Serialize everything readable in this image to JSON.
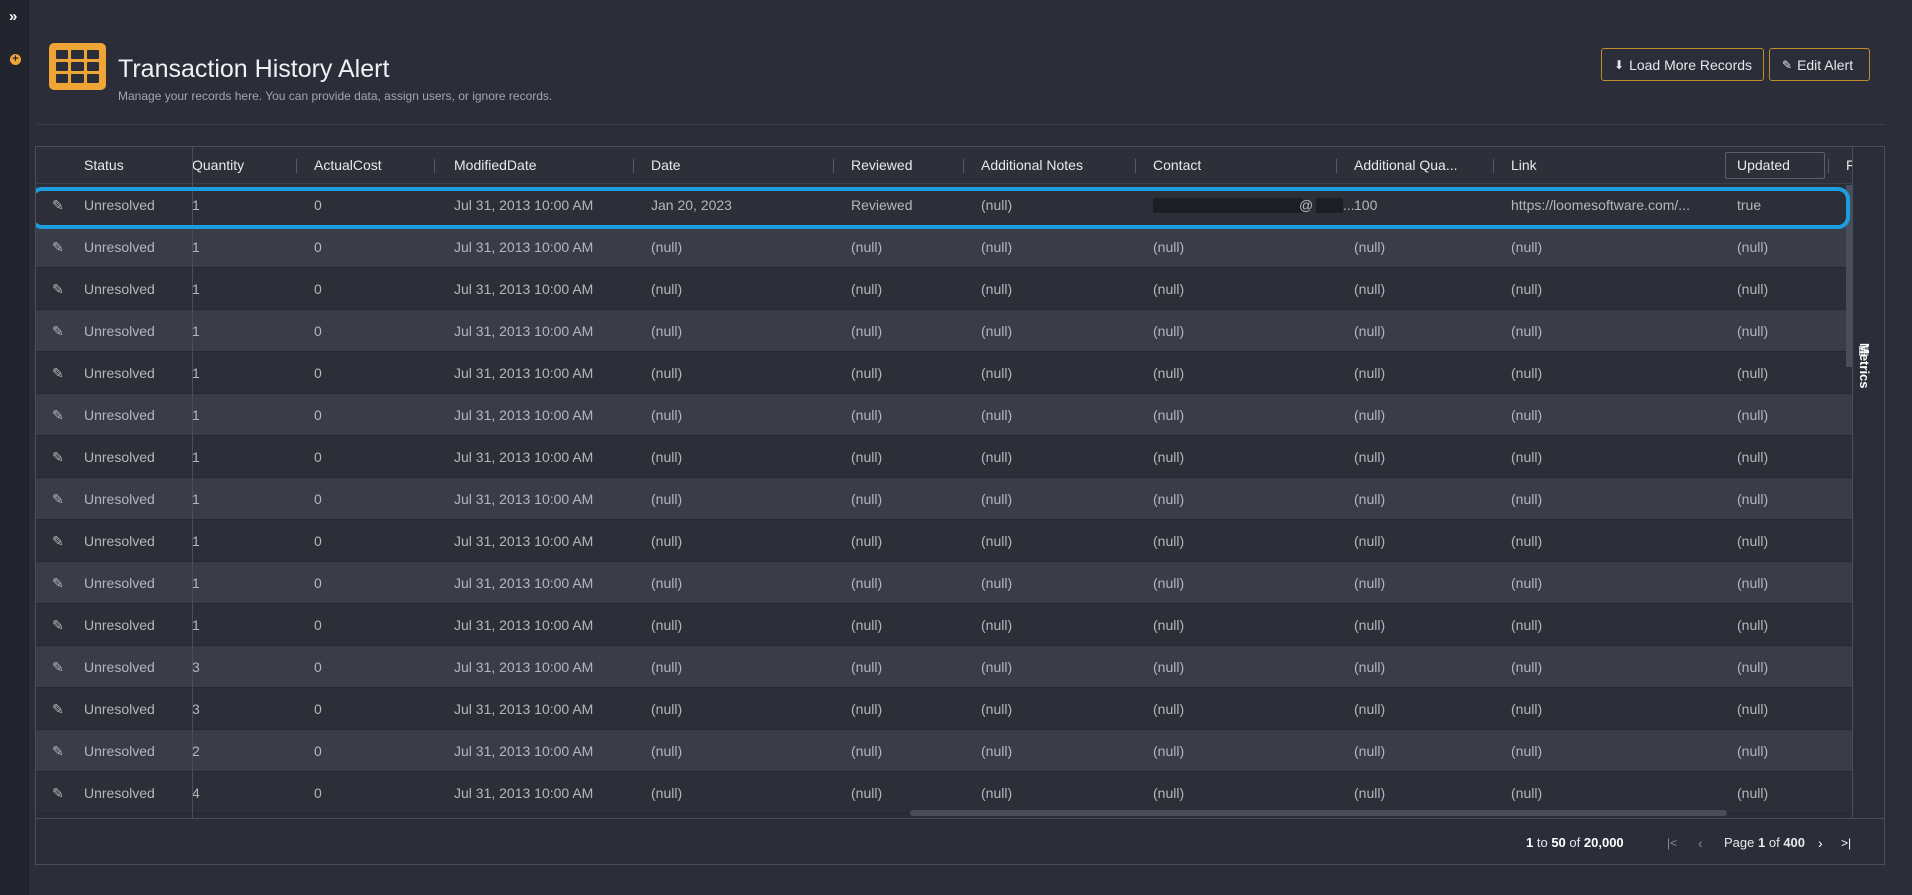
{
  "leftbar": {
    "expand_glyph": "»",
    "add_glyph": "+"
  },
  "header": {
    "icon": "table-grid-icon",
    "title": "Transaction History Alert",
    "subtitle": "Manage your records here. You can provide data, assign users, or ignore records."
  },
  "buttons": {
    "load_more": "Load More Records",
    "edit_alert": "Edit Alert"
  },
  "grid": {
    "columns": [
      "Status",
      "Quantity",
      "ActualCost",
      "ModifiedDate",
      "Date",
      "Reviewed",
      "Additional Notes",
      "Contact",
      "Additional Qua...",
      "Link",
      "Updated",
      "F"
    ],
    "rows": [
      {
        "status": "Unresolved",
        "quantity": "1",
        "actual_cost": "0",
        "modified_date": "Jul 31, 2013 10:00 AM",
        "date": "Jan 20, 2023",
        "reviewed": "Reviewed",
        "notes": "(null)",
        "contact": "@",
        "contact_tail": "...",
        "add_qty": "100",
        "link": "https://loomesoftware.com/...",
        "updated": "true"
      },
      {
        "status": "Unresolved",
        "quantity": "1",
        "actual_cost": "0",
        "modified_date": "Jul 31, 2013 10:00 AM",
        "date": "(null)",
        "reviewed": "(null)",
        "notes": "(null)",
        "contact": "(null)",
        "contact_tail": "",
        "add_qty": "(null)",
        "link": "(null)",
        "updated": "(null)"
      },
      {
        "status": "Unresolved",
        "quantity": "1",
        "actual_cost": "0",
        "modified_date": "Jul 31, 2013 10:00 AM",
        "date": "(null)",
        "reviewed": "(null)",
        "notes": "(null)",
        "contact": "(null)",
        "contact_tail": "",
        "add_qty": "(null)",
        "link": "(null)",
        "updated": "(null)"
      },
      {
        "status": "Unresolved",
        "quantity": "1",
        "actual_cost": "0",
        "modified_date": "Jul 31, 2013 10:00 AM",
        "date": "(null)",
        "reviewed": "(null)",
        "notes": "(null)",
        "contact": "(null)",
        "contact_tail": "",
        "add_qty": "(null)",
        "link": "(null)",
        "updated": "(null)"
      },
      {
        "status": "Unresolved",
        "quantity": "1",
        "actual_cost": "0",
        "modified_date": "Jul 31, 2013 10:00 AM",
        "date": "(null)",
        "reviewed": "(null)",
        "notes": "(null)",
        "contact": "(null)",
        "contact_tail": "",
        "add_qty": "(null)",
        "link": "(null)",
        "updated": "(null)"
      },
      {
        "status": "Unresolved",
        "quantity": "1",
        "actual_cost": "0",
        "modified_date": "Jul 31, 2013 10:00 AM",
        "date": "(null)",
        "reviewed": "(null)",
        "notes": "(null)",
        "contact": "(null)",
        "contact_tail": "",
        "add_qty": "(null)",
        "link": "(null)",
        "updated": "(null)"
      },
      {
        "status": "Unresolved",
        "quantity": "1",
        "actual_cost": "0",
        "modified_date": "Jul 31, 2013 10:00 AM",
        "date": "(null)",
        "reviewed": "(null)",
        "notes": "(null)",
        "contact": "(null)",
        "contact_tail": "",
        "add_qty": "(null)",
        "link": "(null)",
        "updated": "(null)"
      },
      {
        "status": "Unresolved",
        "quantity": "1",
        "actual_cost": "0",
        "modified_date": "Jul 31, 2013 10:00 AM",
        "date": "(null)",
        "reviewed": "(null)",
        "notes": "(null)",
        "contact": "(null)",
        "contact_tail": "",
        "add_qty": "(null)",
        "link": "(null)",
        "updated": "(null)"
      },
      {
        "status": "Unresolved",
        "quantity": "1",
        "actual_cost": "0",
        "modified_date": "Jul 31, 2013 10:00 AM",
        "date": "(null)",
        "reviewed": "(null)",
        "notes": "(null)",
        "contact": "(null)",
        "contact_tail": "",
        "add_qty": "(null)",
        "link": "(null)",
        "updated": "(null)"
      },
      {
        "status": "Unresolved",
        "quantity": "1",
        "actual_cost": "0",
        "modified_date": "Jul 31, 2013 10:00 AM",
        "date": "(null)",
        "reviewed": "(null)",
        "notes": "(null)",
        "contact": "(null)",
        "contact_tail": "",
        "add_qty": "(null)",
        "link": "(null)",
        "updated": "(null)"
      },
      {
        "status": "Unresolved",
        "quantity": "1",
        "actual_cost": "0",
        "modified_date": "Jul 31, 2013 10:00 AM",
        "date": "(null)",
        "reviewed": "(null)",
        "notes": "(null)",
        "contact": "(null)",
        "contact_tail": "",
        "add_qty": "(null)",
        "link": "(null)",
        "updated": "(null)"
      },
      {
        "status": "Unresolved",
        "quantity": "3",
        "actual_cost": "0",
        "modified_date": "Jul 31, 2013 10:00 AM",
        "date": "(null)",
        "reviewed": "(null)",
        "notes": "(null)",
        "contact": "(null)",
        "contact_tail": "",
        "add_qty": "(null)",
        "link": "(null)",
        "updated": "(null)"
      },
      {
        "status": "Unresolved",
        "quantity": "3",
        "actual_cost": "0",
        "modified_date": "Jul 31, 2013 10:00 AM",
        "date": "(null)",
        "reviewed": "(null)",
        "notes": "(null)",
        "contact": "(null)",
        "contact_tail": "",
        "add_qty": "(null)",
        "link": "(null)",
        "updated": "(null)"
      },
      {
        "status": "Unresolved",
        "quantity": "2",
        "actual_cost": "0",
        "modified_date": "Jul 31, 2013 10:00 AM",
        "date": "(null)",
        "reviewed": "(null)",
        "notes": "(null)",
        "contact": "(null)",
        "contact_tail": "",
        "add_qty": "(null)",
        "link": "(null)",
        "updated": "(null)"
      },
      {
        "status": "Unresolved",
        "quantity": "4",
        "actual_cost": "0",
        "modified_date": "Jul 31, 2013 10:00 AM",
        "date": "(null)",
        "reviewed": "(null)",
        "notes": "(null)",
        "contact": "(null)",
        "contact_tail": "",
        "add_qty": "(null)",
        "link": "(null)",
        "updated": "(null)"
      }
    ],
    "metrics_label": "Metrics"
  },
  "pagination": {
    "range_from": "1",
    "range_to_word": "to",
    "range_to": "50",
    "range_of_word": "of",
    "total": "20,000",
    "page_word": "Page",
    "page": "1",
    "of_word": "of",
    "page_count": "400"
  },
  "colors": {
    "accent": "#f0a636",
    "highlight": "#1b9ee0",
    "background": "#2b2e38"
  }
}
